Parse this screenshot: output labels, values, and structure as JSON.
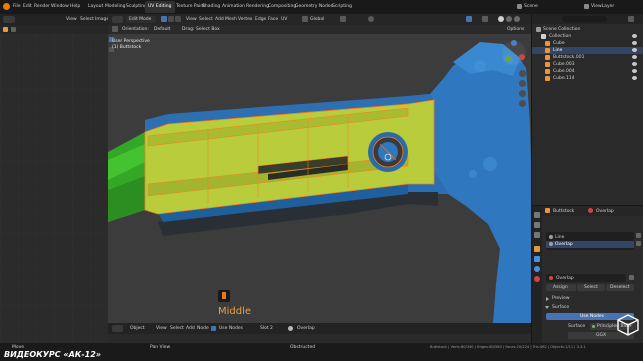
{
  "app": {
    "menu": [
      "File",
      "Edit",
      "Render",
      "Window",
      "Help"
    ],
    "workspaces": [
      "Layout",
      "Modeling",
      "Sculpting",
      "UV Editing",
      "Texture Paint",
      "Shading",
      "Animation",
      "Rendering",
      "Compositing",
      "Geometry Nodes",
      "Scripting"
    ],
    "active_workspace": "UV Editing",
    "scene": "Scene",
    "view_layer": "ViewLayer"
  },
  "uv_editor": {
    "header": [
      "View",
      "Select",
      "Image"
    ],
    "bottom_label": "Move"
  },
  "viewport": {
    "mode": "Edit Mode",
    "header": [
      "View",
      "Select",
      "Add",
      "Mesh",
      "Vertex",
      "Edge",
      "Face",
      "UV"
    ],
    "orientation_label": "Orientation:",
    "orientation": "Default",
    "drag_label": "Drag:",
    "drag": "Select Box",
    "transform": "Global",
    "options": "Options",
    "view_name": "User Perspective",
    "object_name": "(1) Buttstock",
    "overlay_label": "Middle",
    "bottom_label": "Pan View",
    "bottom_right_label": "Obstructed"
  },
  "node_editor": {
    "header": [
      "Object",
      "View",
      "Select",
      "Add",
      "Node"
    ],
    "use_nodes": "Use Nodes",
    "slot": "Slot 2",
    "material": "Overlap",
    "status": "Buttstock | Verts:80/340 | Edges:80/580 | Faces:20/224 | Tris:462 | Objects:1/11 | 3.3.1"
  },
  "outliner": {
    "title": "Scene Collection",
    "items": [
      "Collection",
      "Cube",
      "Line",
      "Buttstock.001",
      "Cube.003",
      "Cube.004",
      "Cube.114"
    ]
  },
  "properties": {
    "object": "Buttstock",
    "material_tab": "Overlap",
    "slots": [
      "Line",
      "Overlap"
    ],
    "material_field": "Overlap",
    "tabs": [
      "Assign",
      "Select",
      "Deselect"
    ],
    "panels": [
      "Preview",
      "Surface"
    ],
    "use_nodes": "Use Nodes",
    "surface_label": "Surface",
    "surface_value": "Principled BSDF",
    "bsdf_value": "GGX"
  },
  "footer": {
    "course_title": "ВИДЕОКУРС «АК-12»"
  },
  "colors": {
    "accent_blue": "#4772b3",
    "mesh_blue": "#2f78bf",
    "selection_yellow": "#b9cc3c",
    "edge_orange": "#ff7a1a",
    "green_part": "#38b82c",
    "background": "#1d1d1d"
  }
}
